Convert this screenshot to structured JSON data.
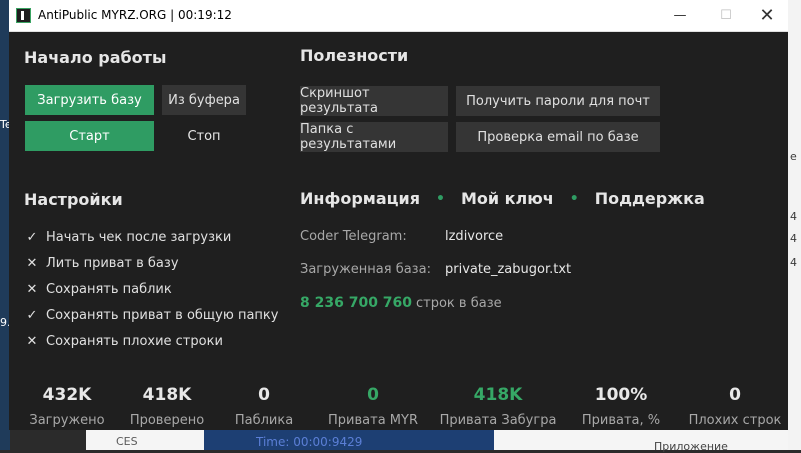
{
  "window": {
    "title": "AntiPublic MYRZ.ORG | 00:19:12"
  },
  "start": {
    "heading": "Начало работы",
    "load_base": "Загрузить базу",
    "from_clipboard": "Из буфера",
    "start": "Старт",
    "stop": "Стоп"
  },
  "useful": {
    "heading": "Полезности",
    "screenshot": "Скриншот результата",
    "get_passwords": "Получить пароли для почт",
    "results_folder": "Папка с результатами",
    "check_email": "Проверка email по базе"
  },
  "settings": {
    "heading": "Настройки",
    "items": [
      {
        "label": "Начать чек после загрузки",
        "mark": "✓"
      },
      {
        "label": "Лить приват в базу",
        "mark": "✕"
      },
      {
        "label": "Сохранять паблик",
        "mark": "✕"
      },
      {
        "label": "Сохранять приват в общую папку",
        "mark": "✓"
      },
      {
        "label": "Сохранять плохие строки",
        "mark": "✕"
      }
    ]
  },
  "info": {
    "tab_info": "Информация",
    "tab_key": "Мой ключ",
    "tab_support": "Поддержка",
    "coder_label": "Coder Telegram:",
    "coder_value": "lzdivorce",
    "base_label": "Загруженная база:",
    "base_value": "private_zabugor.txt",
    "line_count": "8 236 700 760",
    "line_count_label": "строк в базе"
  },
  "stats": [
    {
      "value": "432K",
      "label": "Загружено"
    },
    {
      "value": "418K",
      "label": "Проверено"
    },
    {
      "value": "0",
      "label": "Паблика"
    },
    {
      "value": "0",
      "label": "Привата MYR"
    },
    {
      "value": "418K",
      "label": "Привата Забугра"
    },
    {
      "value": "100%",
      "label": "Привата, %"
    },
    {
      "value": "0",
      "label": "Плохих строк"
    }
  ],
  "background": {
    "bottom_time": "Time: 00:00:9429",
    "bottom_right": "Приложение"
  },
  "colors": {
    "accent": "#2f9c63",
    "panel": "#1f1f1f"
  }
}
